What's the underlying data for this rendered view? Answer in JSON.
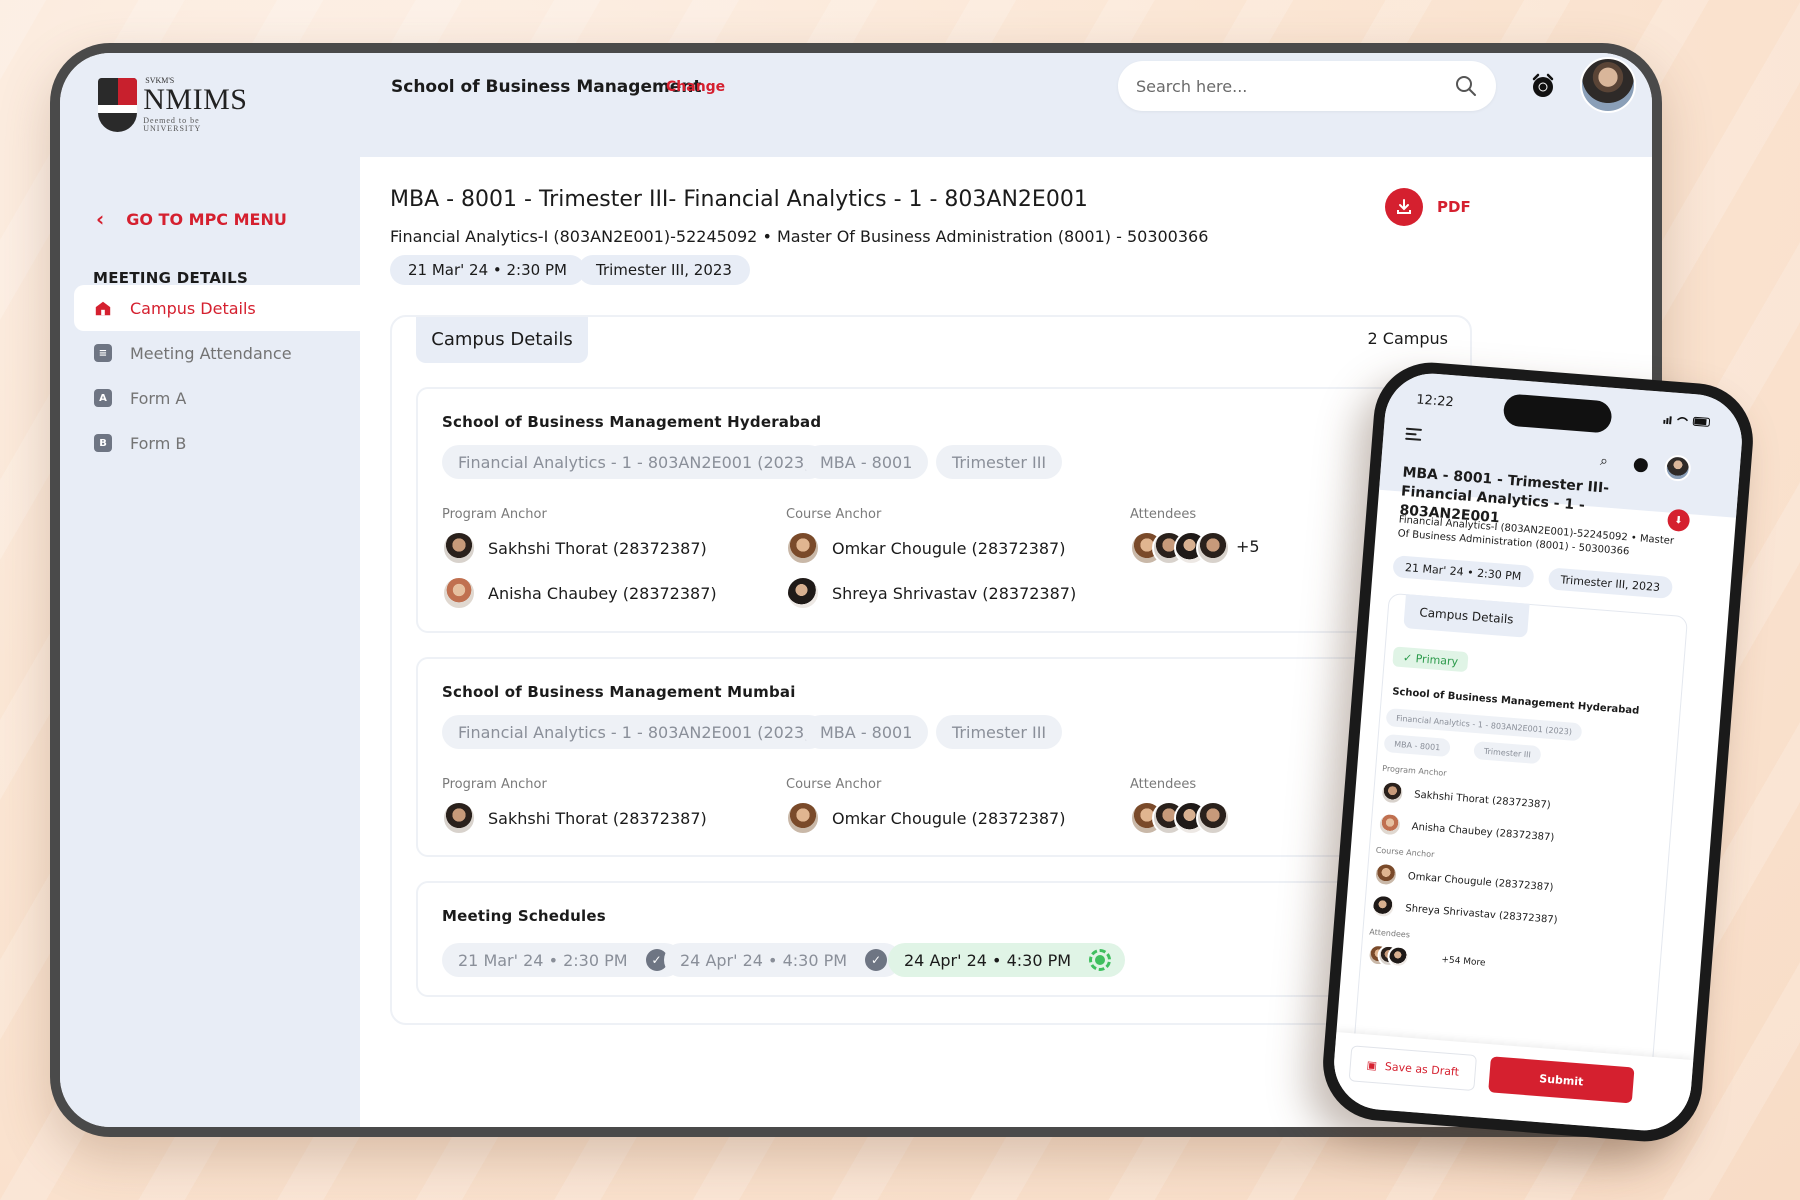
{
  "logo": {
    "small": "SVKM'S",
    "main": "NMIMS",
    "sub": "Deemed to be UNIVERSITY"
  },
  "header": {
    "school": "School of Business Management",
    "change": "Change",
    "search_placeholder": "Search here..."
  },
  "sidebar": {
    "back": "GO TO MPC MENU",
    "section_title": "MEETING DETAILS",
    "items": [
      {
        "label": "Campus Details",
        "icon": "campus-icon",
        "badge": ""
      },
      {
        "label": "Meeting Attendance",
        "icon": "checklist-icon",
        "badge": ""
      },
      {
        "label": "Form A",
        "icon": "form-a-icon",
        "badge": "A"
      },
      {
        "label": "Form B",
        "icon": "form-b-icon",
        "badge": "B"
      }
    ]
  },
  "main": {
    "title": "MBA - 8001 - Trimester III- Financial Analytics - 1 - 803AN2E001",
    "subtitle": "Financial Analytics-I (803AN2E001)-52245092  •  Master Of Business Administration (8001) - 50300366",
    "date": "21 Mar' 24  •  2:30 PM",
    "term": "Trimester III, 2023",
    "pdf": "PDF",
    "panel_tab": "Campus Details",
    "campus_count": "2 Campus",
    "labels": {
      "program_anchor": "Program Anchor",
      "course_anchor": "Course Anchor",
      "attendees": "Attendees"
    },
    "campuses": [
      {
        "name": "School of Business Management Hyderabad",
        "tags": [
          "Financial Analytics - 1 - 803AN2E001 (2023)",
          "MBA - 8001",
          "Trimester III"
        ],
        "program_anchors": [
          "Sakhshi Thorat (28372387)",
          "Anisha Chaubey (28372387)"
        ],
        "course_anchors": [
          "Omkar Chougule (28372387)",
          "Shreya Shrivastav (28372387)"
        ],
        "attendees_more": "+5"
      },
      {
        "name": "School of Business Management Mumbai",
        "tags": [
          "Financial Analytics - 1 - 803AN2E001 (2023)",
          "MBA - 8001",
          "Trimester III"
        ],
        "program_anchors": [
          "Sakhshi Thorat (28372387)"
        ],
        "course_anchors": [
          "Omkar Chougule (28372387)"
        ]
      }
    ],
    "schedules_title": "Meeting Schedules",
    "schedules": [
      "21 Mar' 24  •  2:30 PM",
      "24 Apr' 24  •  4:30 PM",
      "24 Apr' 24  •  4:30 PM"
    ]
  },
  "phone": {
    "time": "12:22",
    "title": "MBA - 8001 - Trimester III- Financial Analytics - 1 - 803AN2E001",
    "subtitle": "Financial Analytics-I (803AN2E001)-52245092  •  Master Of Business Administration (8001) - 50300366",
    "date": "21 Mar' 24  •  2:30 PM",
    "term": "Trimester III, 2023",
    "tab": "Campus Details",
    "primary": "✓  Primary",
    "campus_name": "School of Business Management Hyderabad",
    "tags": [
      "Financial Analytics - 1 - 803AN2E001 (2023)",
      "MBA - 8001",
      "Trimester III"
    ],
    "program_anchor_label": "Program Anchor",
    "course_anchor_label": "Course Anchor",
    "attendees_label": "Attendees",
    "program_anchors": [
      "Sakhshi Thorat (28372387)",
      "Anisha Chaubey (28372387)"
    ],
    "course_anchors": [
      "Omkar Chougule (28372387)",
      "Shreya Shrivastav (28372387)"
    ],
    "more": "+54 More",
    "save_draft": "Save as Draft",
    "submit": "Submit"
  },
  "colors": {
    "accent": "#d5202f",
    "sidebar_bg": "#e8edf6",
    "live_green": "#3fbf5f"
  }
}
